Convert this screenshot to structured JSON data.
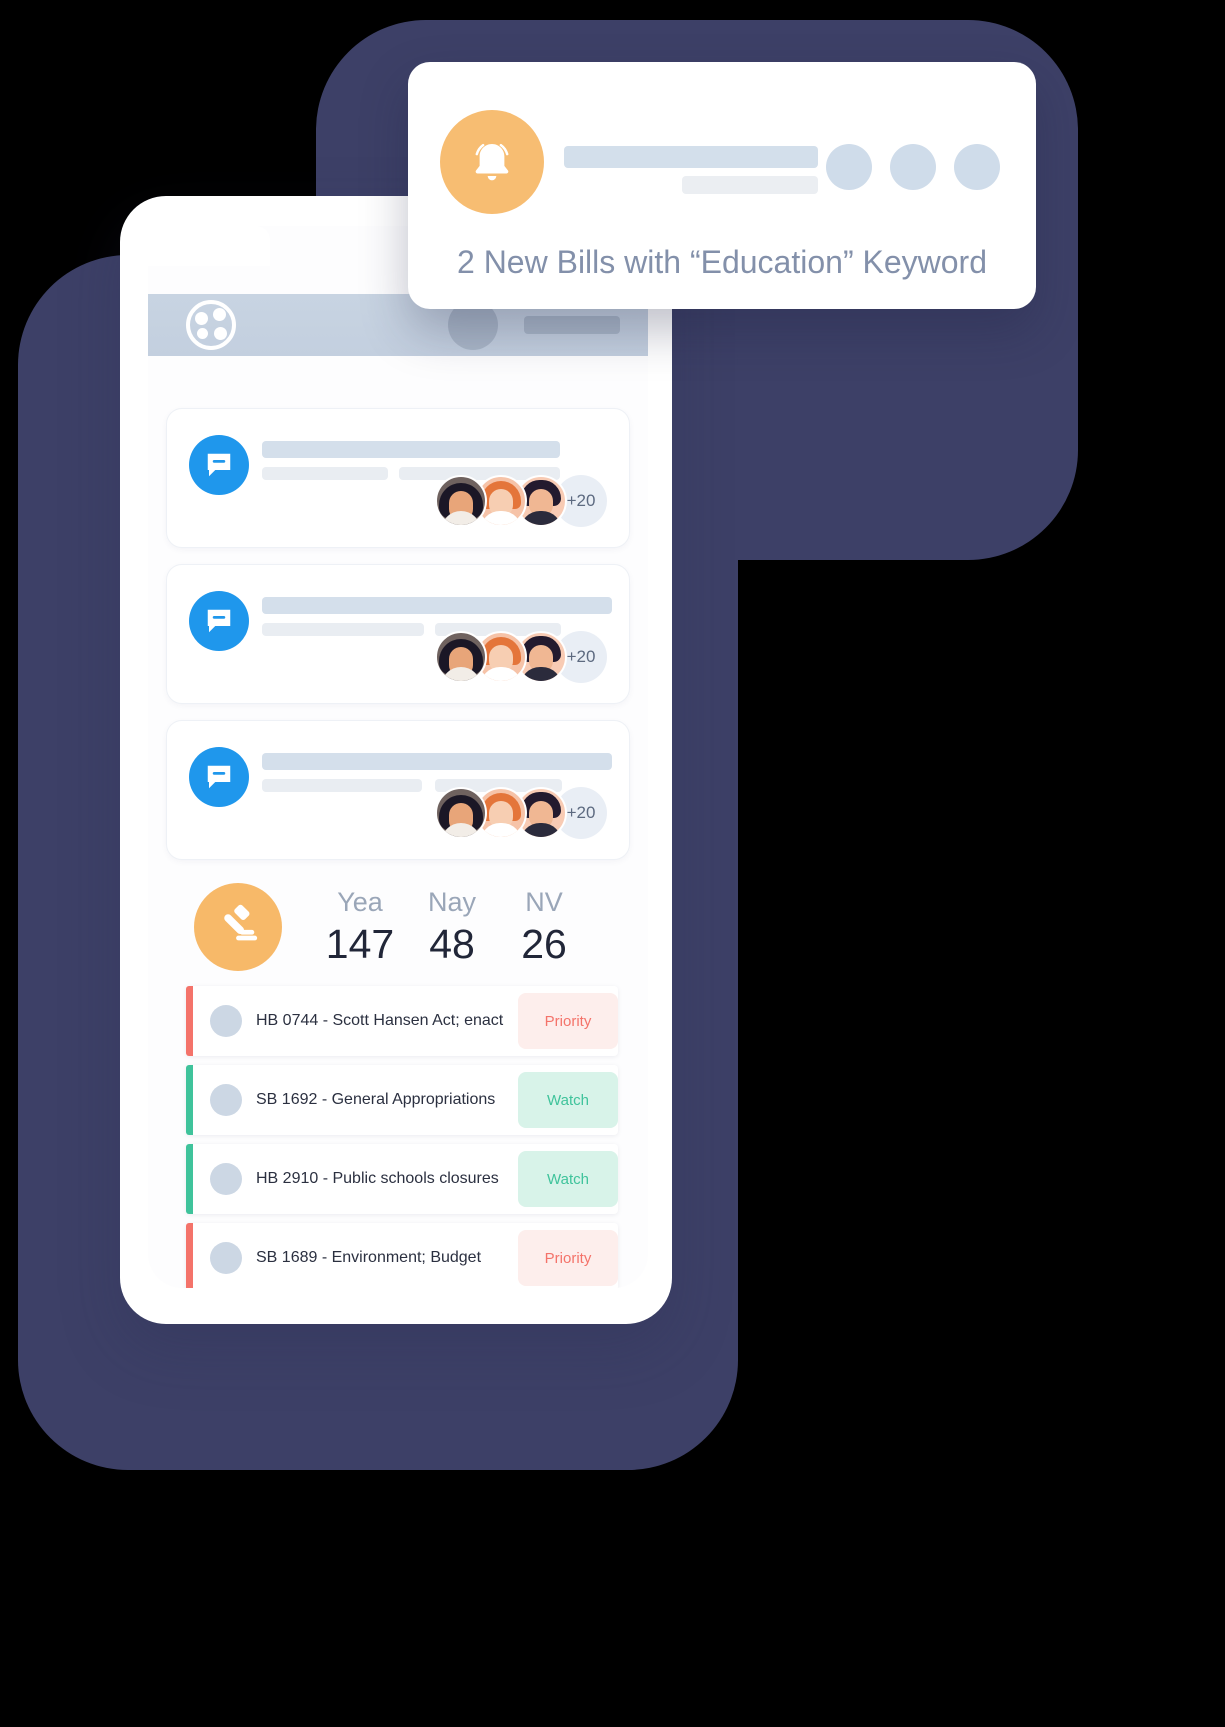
{
  "notification": {
    "icon": "bell-icon",
    "message": "2 New Bills with “Education” Keyword",
    "accent_color": "#f7bd72"
  },
  "phone": {
    "header": {
      "logo": "app-logo-icon"
    },
    "messages": [
      {
        "icon": "chat-bubble-icon",
        "overflow_count": "+20"
      },
      {
        "icon": "chat-bubble-icon",
        "overflow_count": "+20"
      },
      {
        "icon": "chat-bubble-icon",
        "overflow_count": "+20"
      }
    ],
    "vote_summary": {
      "icon": "gavel-icon",
      "stats": [
        {
          "label": "Yea",
          "value": "147"
        },
        {
          "label": "Nay",
          "value": "48"
        },
        {
          "label": "NV",
          "value": "26"
        }
      ]
    },
    "bills": [
      {
        "title": "HB 0744 - Scott Hansen Act; enact",
        "badge": "Priority",
        "status": "priority",
        "accent": "#f4736a"
      },
      {
        "title": "SB 1692 - General Appropriations",
        "badge": "Watch",
        "status": "watch",
        "accent": "#3fc39b"
      },
      {
        "title": "HB 2910 - Public schools closures",
        "badge": "Watch",
        "status": "watch",
        "accent": "#3fc39b"
      },
      {
        "title": "SB 1689 - Environment; Budget",
        "badge": "Priority",
        "status": "priority",
        "accent": "#f4736a"
      }
    ]
  },
  "theme": {
    "background": "#000000",
    "panel": "#3d4067",
    "chat_blue": "#1f97ec",
    "orange": "#f7b969"
  }
}
